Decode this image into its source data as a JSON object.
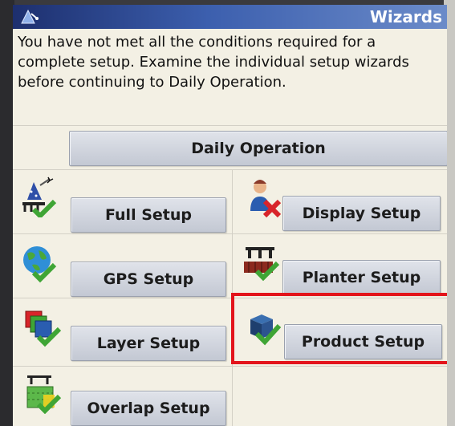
{
  "window": {
    "title": "Wizards",
    "title_icon": "wizard-hat-icon"
  },
  "message": "You have not met all the conditions required for a complete setup. Examine the individual setup wizards before continuing to Daily Operation.",
  "buttons": {
    "daily_operation": "Daily Operation",
    "full_setup": "Full Setup",
    "display_setup": "Display Setup",
    "gps_setup": "GPS Setup",
    "planter_setup": "Planter Setup",
    "layer_setup": "Layer Setup",
    "product_setup": "Product Setup",
    "overlap_setup": "Overlap Setup"
  },
  "icons": {
    "full_setup": "wizard-check-icon",
    "display_setup": "person-x-icon",
    "gps_setup": "globe-check-icon",
    "planter_setup": "planter-check-icon",
    "layer_setup": "layers-check-icon",
    "product_setup": "product-box-check-icon",
    "overlap_setup": "overlap-check-icon"
  },
  "colors": {
    "titlebar": "#1d2f6e",
    "background": "#f3f0e4",
    "button": "#c3c8d3",
    "check_green": "#3fa535",
    "highlight": "#e3141b"
  }
}
